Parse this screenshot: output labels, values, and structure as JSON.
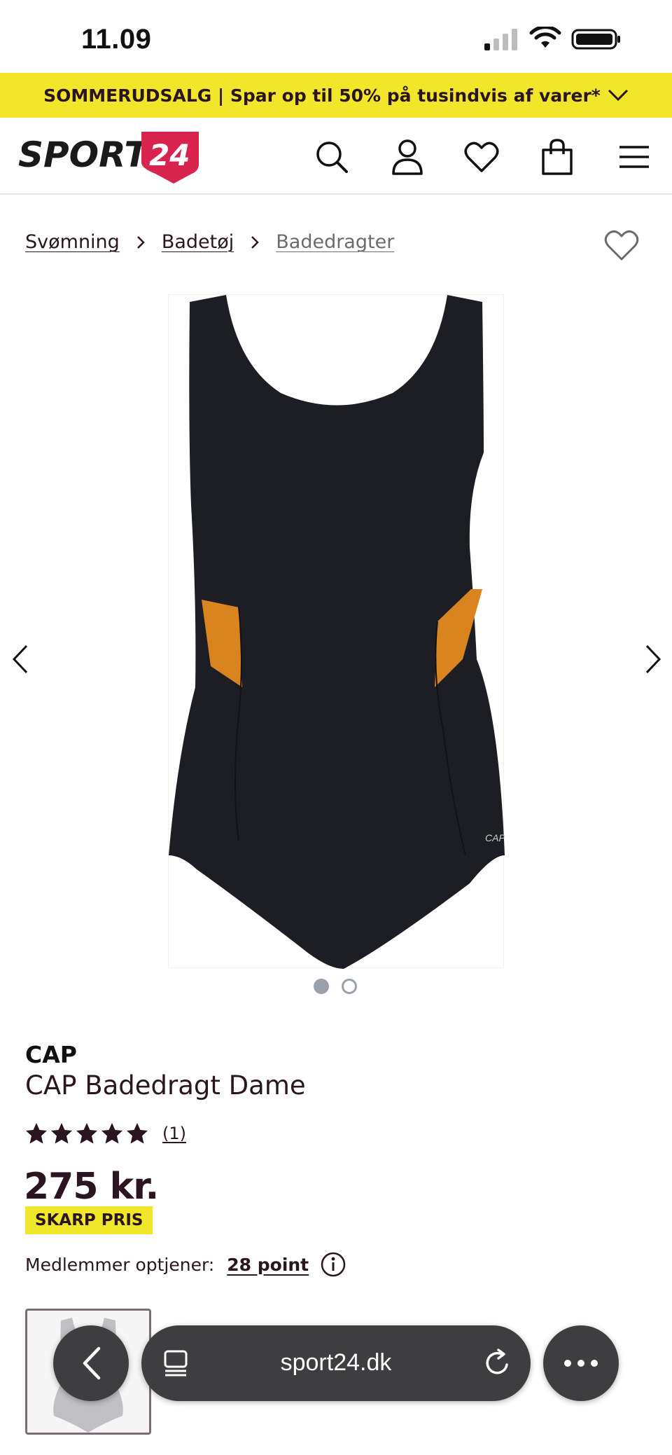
{
  "status_bar": {
    "time": "11.09"
  },
  "promo": {
    "text": "SOMMERUDSALG | Spar op til 50% på tusindvis af varer*",
    "background": "#f2e62a"
  },
  "header": {
    "logo_text": "SPORT",
    "logo_badge": "24",
    "logo_badge_color": "#d9234f",
    "icons": [
      "search-icon",
      "account-icon",
      "wishlist-icon",
      "cart-icon",
      "menu-icon"
    ]
  },
  "breadcrumb": {
    "items": [
      {
        "label": "Svømning"
      },
      {
        "label": "Badetøj"
      },
      {
        "label": "Badedragter"
      }
    ]
  },
  "gallery": {
    "image_count": 2,
    "active_index": 0,
    "accent": "#d9841f"
  },
  "product": {
    "brand": "CAP",
    "title": "CAP Badedragt Dame",
    "rating": 5,
    "rating_count": "(1)",
    "price": "275 kr.",
    "badge": "SKARP PRIS",
    "members_label": "Medlemmer optjener:",
    "points": "28 point"
  },
  "browser": {
    "url": "sport24.dk"
  }
}
